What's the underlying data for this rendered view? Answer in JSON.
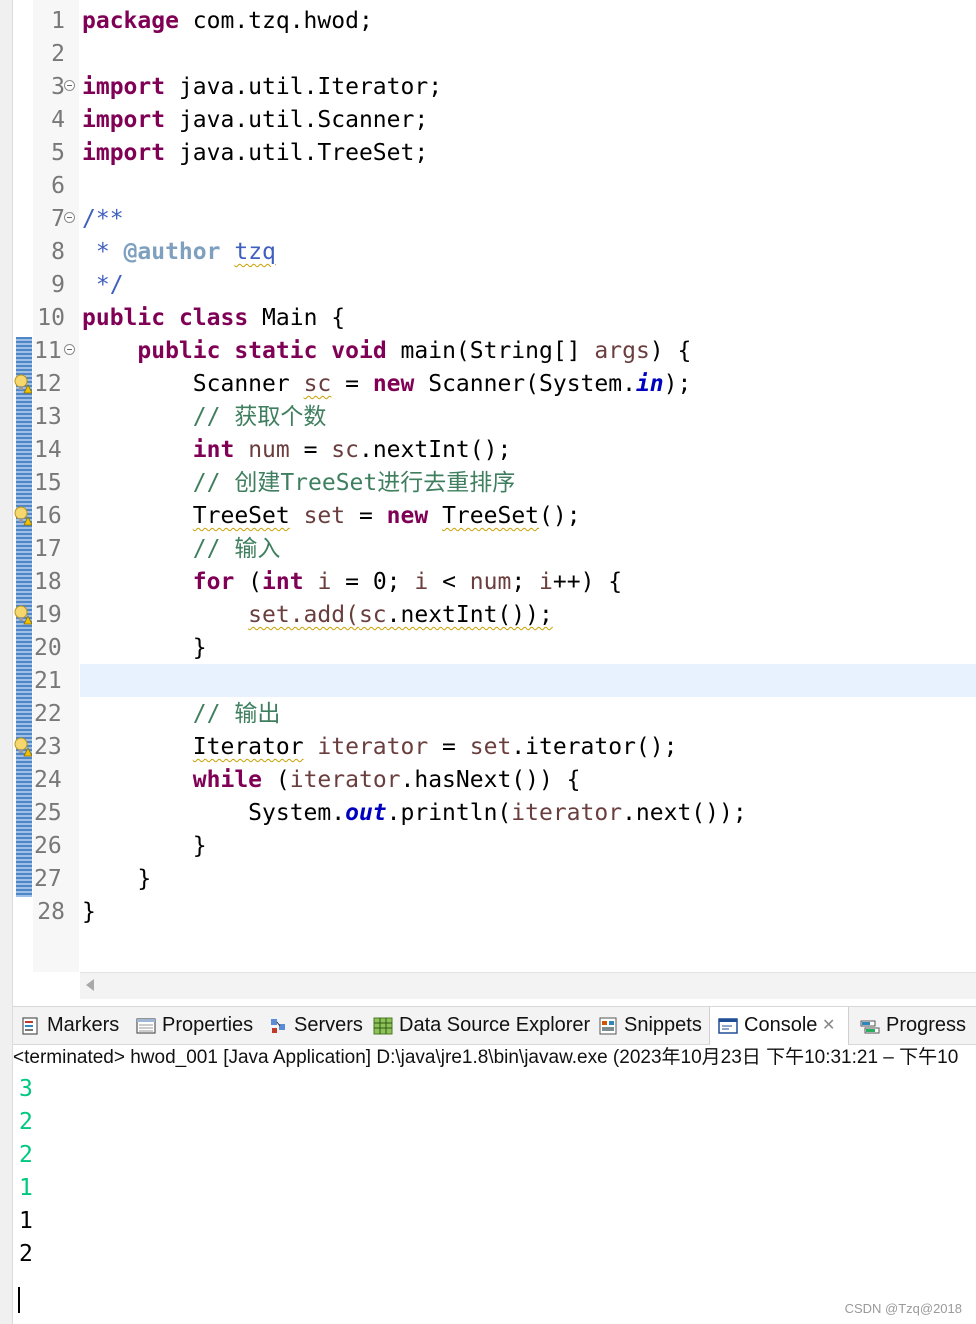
{
  "editor": {
    "lines": [
      {
        "n": "1"
      },
      {
        "n": "2"
      },
      {
        "n": "3"
      },
      {
        "n": "4"
      },
      {
        "n": "5"
      },
      {
        "n": "6"
      },
      {
        "n": "7"
      },
      {
        "n": "8"
      },
      {
        "n": "9"
      },
      {
        "n": "10"
      },
      {
        "n": "11"
      },
      {
        "n": "12"
      },
      {
        "n": "13"
      },
      {
        "n": "14"
      },
      {
        "n": "15"
      },
      {
        "n": "16"
      },
      {
        "n": "17"
      },
      {
        "n": "18"
      },
      {
        "n": "19"
      },
      {
        "n": "20"
      },
      {
        "n": "21"
      },
      {
        "n": "22"
      },
      {
        "n": "23"
      },
      {
        "n": "24"
      },
      {
        "n": "25"
      },
      {
        "n": "26"
      },
      {
        "n": "27"
      },
      {
        "n": "28"
      }
    ],
    "tokens": {
      "l1": [
        "package",
        " com.tzq.hwod;"
      ],
      "l3": [
        "import",
        " java.util.Iterator;"
      ],
      "l4": [
        "import",
        " java.util.Scanner;"
      ],
      "l5": [
        "import",
        " java.util.TreeSet;"
      ],
      "l7": [
        "/**"
      ],
      "l8": [
        " * ",
        "@author",
        " ",
        "tzq"
      ],
      "l9": [
        " */"
      ],
      "l10": [
        "public",
        " ",
        "class",
        " Main {"
      ],
      "l11": [
        "    ",
        "public",
        " ",
        "static",
        " ",
        "void",
        " main(String[] ",
        "args",
        ") {"
      ],
      "l12": [
        "        ",
        "Scanner",
        " ",
        "sc",
        " = ",
        "new",
        " Scanner(System.",
        "in",
        ");"
      ],
      "l13": [
        "        ",
        "// 获取个数"
      ],
      "l14": [
        "        ",
        "int",
        " ",
        "num",
        " = ",
        "sc",
        ".nextInt();"
      ],
      "l15": [
        "        ",
        "// 创建TreeSet进行去重排序"
      ],
      "l16": [
        "        ",
        "TreeSet",
        " ",
        "set",
        " = ",
        "new",
        " ",
        "TreeSet",
        "();"
      ],
      "l17": [
        "        ",
        "// 输入"
      ],
      "l18": [
        "        ",
        "for",
        " (",
        "int",
        " ",
        "i",
        " = 0; ",
        "i",
        " < ",
        "num",
        "; ",
        "i",
        "++) {"
      ],
      "l19": [
        "            ",
        "set.add(",
        "sc",
        ".nextInt());"
      ],
      "l20": [
        "        }"
      ],
      "l22": [
        "        ",
        "// 输出"
      ],
      "l23": [
        "        ",
        "Iterator",
        " ",
        "iterator",
        " = ",
        "set",
        ".iterator();"
      ],
      "l24": [
        "        ",
        "while",
        " (",
        "iterator",
        ".hasNext()) {"
      ],
      "l25": [
        "            System.",
        "out",
        ".println(",
        "iterator",
        ".next());"
      ],
      "l26": [
        "        }"
      ],
      "l27": [
        "    }"
      ],
      "l28": [
        "}"
      ]
    }
  },
  "views": {
    "tabs": [
      {
        "label": "Markers",
        "icon": "markers-icon"
      },
      {
        "label": "Properties",
        "icon": "properties-icon"
      },
      {
        "label": "Servers",
        "icon": "servers-icon"
      },
      {
        "label": "Data Source Explorer",
        "icon": "data-source-explorer-icon"
      },
      {
        "label": "Snippets",
        "icon": "snippets-icon"
      },
      {
        "label": "Console",
        "icon": "console-icon",
        "active": true
      },
      {
        "label": "Progress",
        "icon": "progress-icon"
      }
    ],
    "close_symbol": "✕"
  },
  "console": {
    "header": "<terminated> hwod_001 [Java Application] D:\\java\\jre1.8\\bin\\javaw.exe  (2023年10月23日 下午10:31:21 – 下午10",
    "input_lines": [
      "3",
      "2",
      "2",
      "1"
    ],
    "output_lines": [
      "1",
      "2"
    ],
    "colors": {
      "input": "#00c87f",
      "output": "#000000"
    }
  },
  "watermark": "CSDN @Tzq@2018",
  "colors": {
    "keyword": "#7f0055",
    "comment": "#3f7f5f",
    "javadoc": "#3f5fbf",
    "javadoc_tag": "#7f9fbf",
    "local_var": "#6a3e3e",
    "static_field": "#0000c0",
    "current_line": "#e8f2fe"
  }
}
